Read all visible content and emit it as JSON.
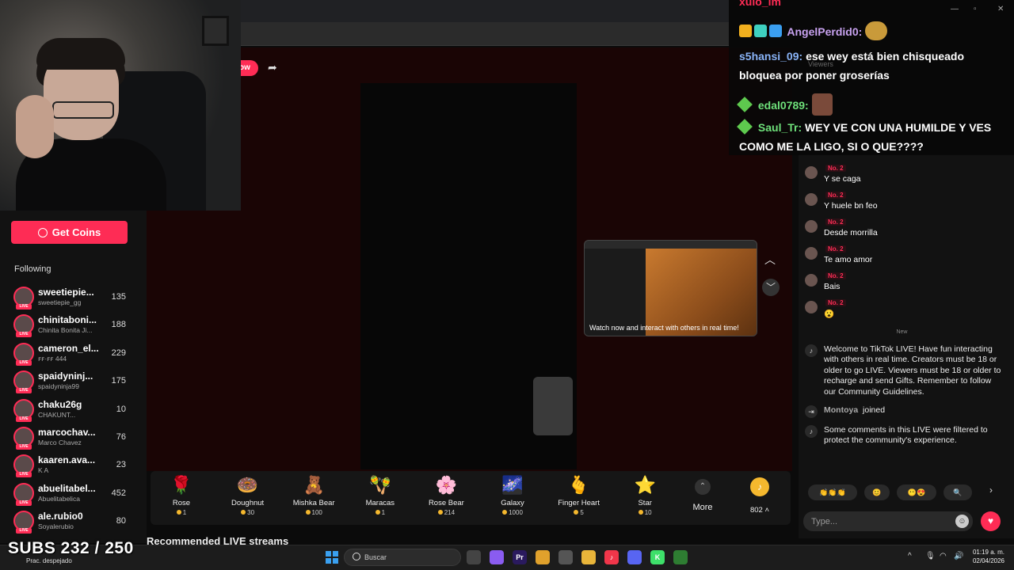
{
  "webcam_label": "",
  "stage": {
    "follow_label": "ow"
  },
  "sidebar": {
    "get_coins": "Get Coins",
    "following_label": "Following",
    "items": [
      {
        "name": "sweetiepie...",
        "sub": "sweetiepie_gg",
        "count": "135"
      },
      {
        "name": "chinitaboni...",
        "sub": "Chinita Bonita Ji...",
        "count": "188"
      },
      {
        "name": "cameron_el...",
        "sub": "ꜰꜰ·ꜰꜰ 444",
        "count": "229"
      },
      {
        "name": "spaidyninj...",
        "sub": "spaidyninja99",
        "count": "175"
      },
      {
        "name": "chaku26g",
        "sub": "CHAKUNT...",
        "count": "10"
      },
      {
        "name": "marcochav...",
        "sub": "Marco Chavez",
        "count": "76"
      },
      {
        "name": "kaaren.ava...",
        "sub": "K A",
        "count": "23"
      },
      {
        "name": "abuelitabel...",
        "sub": "Abuelitabelica",
        "count": "452"
      },
      {
        "name": "ale.rubio0",
        "sub": "Soyalerubio",
        "count": "80"
      }
    ]
  },
  "preview": {
    "caption": "Watch now and interact with others in real time!"
  },
  "gifts": [
    {
      "name": "Rose",
      "price": "1",
      "color": "#e8334a",
      "icon": "rose-icon",
      "glyph": "🌹"
    },
    {
      "name": "Doughnut",
      "price": "30",
      "color": "#f2a7c3",
      "icon": "doughnut-icon",
      "glyph": "🍩"
    },
    {
      "name": "Mishka Bear",
      "price": "100",
      "color": "#a0522d",
      "icon": "bear-icon",
      "glyph": "🧸"
    },
    {
      "name": "Maracas",
      "price": "1",
      "color": "#e24c3a",
      "icon": "maracas-icon",
      "glyph": "🪇"
    },
    {
      "name": "Rose Bear",
      "price": "214",
      "color": "#e8335a",
      "icon": "rose-bear-icon",
      "glyph": "🌸"
    },
    {
      "name": "Galaxy",
      "price": "1000",
      "color": "#6d5ce8",
      "icon": "galaxy-icon",
      "glyph": "🌌"
    },
    {
      "name": "Finger Heart",
      "price": "5",
      "color": "#f0b090",
      "icon": "finger-heart-icon",
      "glyph": "🫰"
    },
    {
      "name": "Star",
      "price": "10",
      "color": "#f2c94c",
      "icon": "star-icon",
      "glyph": "⭐"
    }
  ],
  "more_label": "More",
  "balance": "802",
  "recommended": "Recommended LIVE streams",
  "chat": {
    "messages": [
      {
        "badge": "No. 2",
        "text": "Y se caga"
      },
      {
        "badge": "No. 2",
        "text": "Y huele bn feo"
      },
      {
        "badge": "No. 2",
        "text": "Desde morrilla"
      },
      {
        "badge": "No. 2",
        "text": "Te amo amor"
      },
      {
        "badge": "No. 2",
        "text": "Bais"
      },
      {
        "badge": "No. 2",
        "text": "😮"
      }
    ],
    "new_label": "New",
    "welcome": "Welcome to TikTok LIVE! Have fun interacting with others in real time. Creators must be 18 or older to go LIVE. Viewers must be 18 or older to recharge and send Gifts. Remember to follow our Community Guidelines.",
    "joined_user": "Montoya",
    "joined_text": "joined",
    "filtered": "Some comments in this LIVE were filtered to protect the community's experience.",
    "placeholder": "Type..."
  },
  "overlay": {
    "top_cut": "xulo_im",
    "l1_name": "AngelPerdid0:",
    "l2_name": "s5hansi_09:",
    "l2_text1": "ese wey está bien chisqueado",
    "l2_text2": "bloquea por poner groserías",
    "l3_name": "edal0789:",
    "l4_name": "Saul_Tr:",
    "l4_text1": "WEY VE CON UNA HUMILDE Y VES",
    "l4_text2": "COMO ME LA LIGO, SI O QUE????",
    "viewers_ghost": "Viewers"
  },
  "subs_counter": "SUBS 232 / 250",
  "taskbar": {
    "weather": "Prac. despejado",
    "search_label": "Buscar",
    "time": "01:19 a. m.",
    "date": "02/04/2026",
    "apps": [
      {
        "name": "file-explorer-icon",
        "color": "#444",
        "label": ""
      },
      {
        "name": "copilot-icon",
        "color": "#8a5cf0",
        "label": ""
      },
      {
        "name": "premiere-icon",
        "color": "#2a1a5e",
        "label": "Pr"
      },
      {
        "name": "chrome-icon",
        "color": "#e0a12c",
        "label": ""
      },
      {
        "name": "settings-icon",
        "color": "#555",
        "label": ""
      },
      {
        "name": "folder-icon",
        "color": "#e8b53a",
        "label": ""
      },
      {
        "name": "music-icon",
        "color": "#f0364a",
        "label": "♪"
      },
      {
        "name": "discord-icon",
        "color": "#5865f2",
        "label": ""
      },
      {
        "name": "kick-icon",
        "color": "#3ee06a",
        "label": "K"
      },
      {
        "name": "chrome-active-icon",
        "color": "#2e7d32",
        "label": ""
      }
    ]
  }
}
